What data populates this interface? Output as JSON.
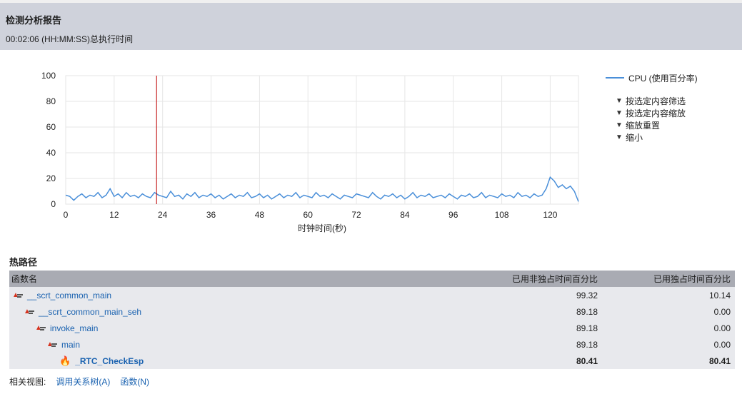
{
  "header": {
    "title": "检测分析报告",
    "duration_value": "00:02:06",
    "duration_format": "(HH:MM:SS)",
    "duration_label": "总执行时间"
  },
  "chart_data": {
    "type": "line",
    "xlabel": "时钟时间(秒)",
    "ylabel": "",
    "xlim": [
      0,
      127
    ],
    "ylim": [
      0,
      100
    ],
    "x_ticks": [
      0,
      12,
      24,
      36,
      48,
      60,
      72,
      84,
      96,
      108,
      120
    ],
    "y_ticks": [
      0,
      20,
      40,
      60,
      80,
      100
    ],
    "grid": true,
    "legend_position": "right",
    "selection_marker_x": 22.5,
    "series": [
      {
        "name": "CPU (使用百分率)",
        "color": "#4a8fd9",
        "x": [
          0,
          1,
          2,
          3,
          4,
          5,
          6,
          7,
          8,
          9,
          10,
          11,
          12,
          13,
          14,
          15,
          16,
          17,
          18,
          19,
          20,
          21,
          22,
          23,
          24,
          25,
          26,
          27,
          28,
          29,
          30,
          31,
          32,
          33,
          34,
          35,
          36,
          37,
          38,
          39,
          40,
          41,
          42,
          43,
          44,
          45,
          46,
          47,
          48,
          49,
          50,
          51,
          52,
          53,
          54,
          55,
          56,
          57,
          58,
          59,
          60,
          61,
          62,
          63,
          64,
          65,
          66,
          67,
          68,
          69,
          70,
          71,
          72,
          73,
          74,
          75,
          76,
          77,
          78,
          79,
          80,
          81,
          82,
          83,
          84,
          85,
          86,
          87,
          88,
          89,
          90,
          91,
          92,
          93,
          94,
          95,
          96,
          97,
          98,
          99,
          100,
          101,
          102,
          103,
          104,
          105,
          106,
          107,
          108,
          109,
          110,
          111,
          112,
          113,
          114,
          115,
          116,
          117,
          118,
          119,
          120,
          121,
          122,
          123,
          124,
          125,
          126,
          127
        ],
        "y": [
          7,
          6,
          3,
          6,
          8,
          5,
          7,
          6,
          9,
          5,
          7,
          12,
          6,
          8,
          5,
          9,
          6,
          7,
          5,
          8,
          6,
          5,
          9,
          7,
          6,
          5,
          10,
          6,
          7,
          4,
          8,
          6,
          9,
          5,
          7,
          6,
          8,
          5,
          7,
          4,
          6,
          8,
          5,
          7,
          6,
          9,
          5,
          6,
          8,
          5,
          7,
          4,
          6,
          8,
          5,
          7,
          6,
          9,
          5,
          7,
          6,
          5,
          9,
          6,
          7,
          5,
          8,
          6,
          4,
          7,
          6,
          5,
          8,
          7,
          6,
          5,
          9,
          6,
          4,
          7,
          6,
          8,
          5,
          7,
          4,
          6,
          9,
          5,
          7,
          6,
          8,
          5,
          6,
          7,
          5,
          8,
          6,
          4,
          7,
          6,
          8,
          5,
          6,
          9,
          5,
          7,
          6,
          5,
          8,
          6,
          7,
          5,
          9,
          6,
          7,
          5,
          8,
          6,
          7,
          12,
          21,
          18,
          13,
          15,
          12,
          14,
          10,
          2
        ]
      }
    ]
  },
  "legend": {
    "series_label": "CPU (使用百分率)",
    "filters": [
      {
        "label": "按选定内容筛选",
        "icon": "filter-icon"
      },
      {
        "label": "按选定内容缩放",
        "icon": "filter-icon"
      },
      {
        "label": "缩放重置",
        "icon": "filter-icon"
      },
      {
        "label": "缩小",
        "icon": "filter-icon"
      }
    ]
  },
  "hot_path": {
    "title": "热路径",
    "columns": [
      "函数名",
      "已用非独占时间百分比",
      "已用独占时间百分比"
    ],
    "rows": [
      {
        "name": "__scrt_common_main",
        "inclusive": "99.32",
        "exclusive": "10.14",
        "icon": "hot-path-icon"
      },
      {
        "name": "__scrt_common_main_seh",
        "inclusive": "89.18",
        "exclusive": "0.00",
        "icon": "hot-path-icon"
      },
      {
        "name": "invoke_main",
        "inclusive": "89.18",
        "exclusive": "0.00",
        "icon": "hot-path-icon"
      },
      {
        "name": "main",
        "inclusive": "89.18",
        "exclusive": "0.00",
        "icon": "hot-path-icon"
      },
      {
        "name": "_RTC_CheckEsp",
        "inclusive": "80.41",
        "exclusive": "80.41",
        "icon": "flame-icon"
      }
    ]
  },
  "related_views": {
    "label": "相关视图:",
    "links": [
      "调用关系树(A)",
      "函数(N)"
    ]
  }
}
